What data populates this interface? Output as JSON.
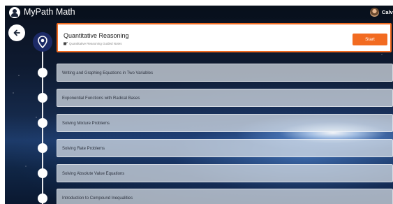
{
  "header": {
    "app_title": "MyPath Math",
    "user_name": "Calv",
    "logo_icon": "person-circle-icon",
    "avatar_icon": "user-avatar-icon"
  },
  "navigation": {
    "back_icon": "arrow-left-icon"
  },
  "current_lesson": {
    "title": "Quantitative Reasoning",
    "subtitle": "Quantitative Reasoning Guided Notes",
    "subtitle_icon": "edit-pencil-icon",
    "node_icon": "location-pin-icon",
    "start_label": "Start",
    "accent_color": "#f26b21"
  },
  "lessons": [
    {
      "title": "Writing and Graphing Equations in Two Variables"
    },
    {
      "title": "Exponential Functions with Radical Bases"
    },
    {
      "title": "Solving Mixture Problems"
    },
    {
      "title": "Solving Rate Problems"
    },
    {
      "title": "Solving Absolute Value Equations"
    },
    {
      "title": "Introduction to Compound Inequalities"
    }
  ]
}
